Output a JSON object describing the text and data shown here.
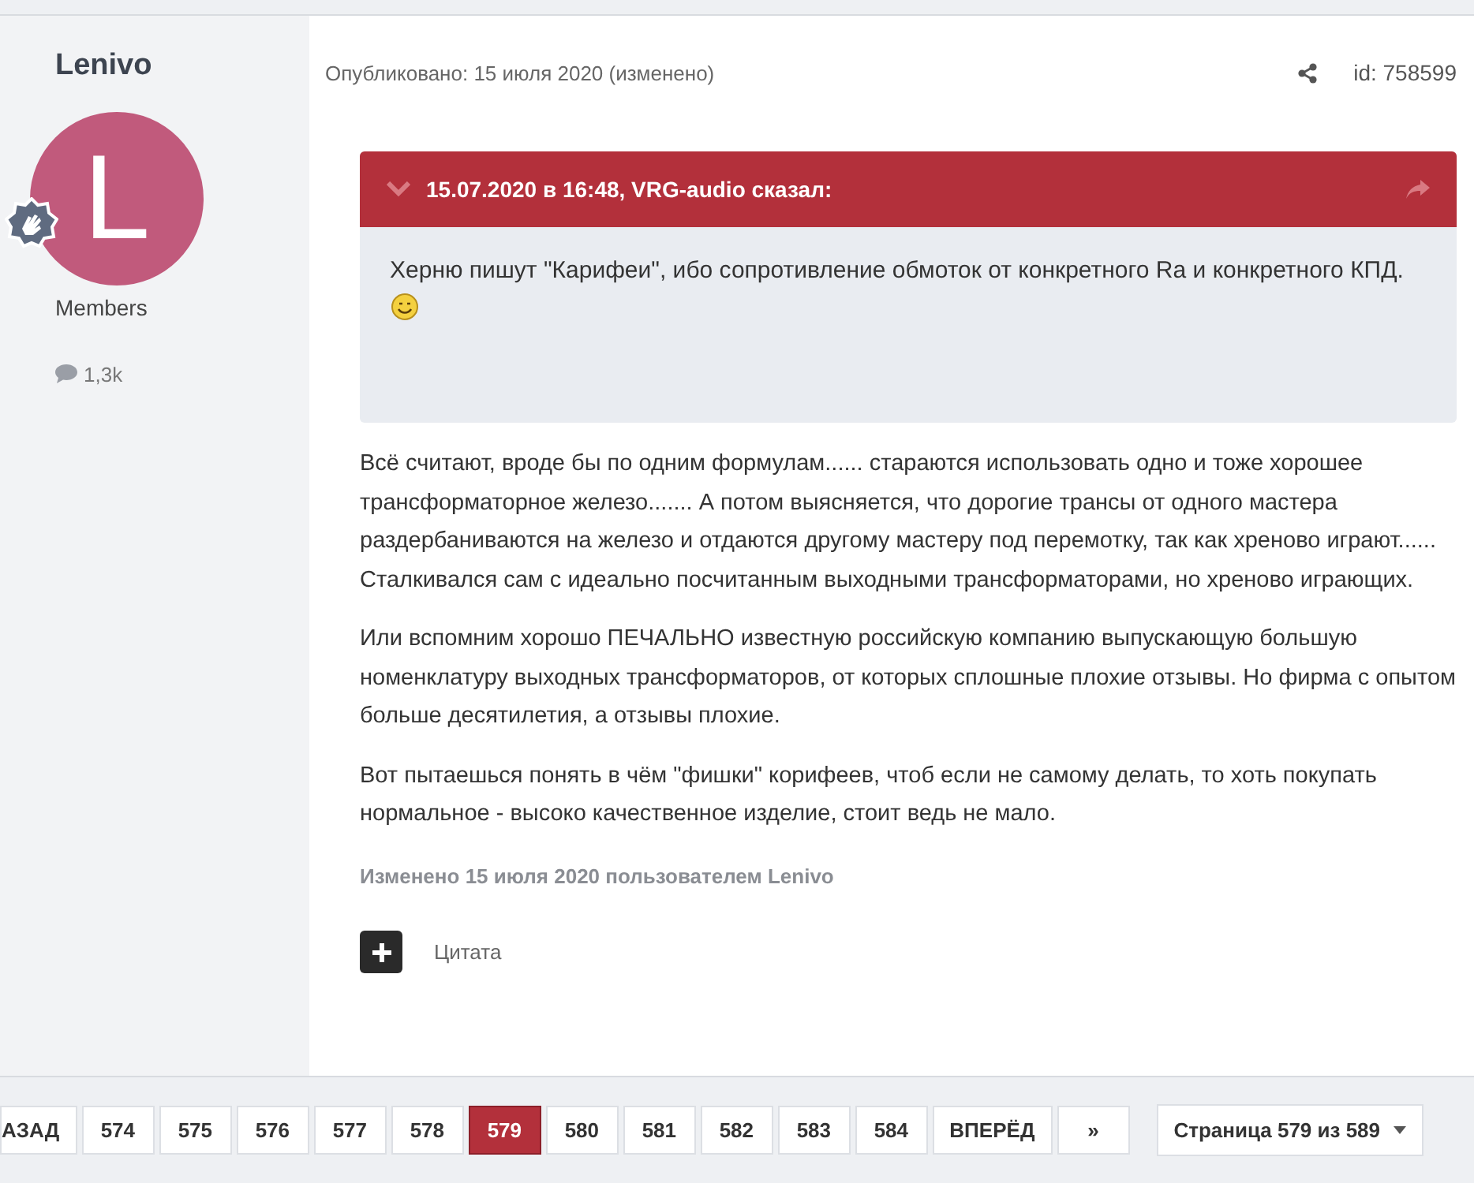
{
  "author": {
    "name": "Lenivo",
    "avatar_letter": "L",
    "group": "Members",
    "posts": "1,3k"
  },
  "post": {
    "published": "Опубликовано: 15 июля 2020 (изменено)",
    "id": "id: 758599",
    "quote": {
      "header": "15.07.2020 в 16:48, VRG-audio сказал:",
      "text": "Херню пишут \"Карифеи\", ибо сопротивление обмоток от конкретного Ra и конкретного КПД."
    },
    "paragraphs": [
      "Всё считают, вроде бы по одним формулам...... стараются использовать одно и тоже хорошее трансформаторное железо....... А потом выясняется, что дорогие трансы от одного мастера раздербаниваются на железо и отдаются другому мастеру под перемотку, так как хреново играют...... Сталкивался сам с идеально посчитанным выходными трансформаторами, но хреново играющих.",
      "Или вспомним хорошо ПЕЧАЛЬНО известную российскую компанию выпускающую большую номенклатуру выходных трансформаторов, от которых сплошные плохие отзывы. Но фирма с опытом больше десятилетия, а отзывы плохие.",
      "Вот пытаешься понять в чём \"фишки\" корифеев, чтоб если не самому делать, то хоть покупать нормальное - высоко качественное изделие, стоит ведь не мало."
    ],
    "edited": "Изменено 15 июля 2020 пользователем Lenivo",
    "quote_button": "Цитата"
  },
  "pagination": {
    "pages": [
      {
        "label": "АЗАД",
        "selected": false
      },
      {
        "label": "574",
        "selected": false
      },
      {
        "label": "575",
        "selected": false
      },
      {
        "label": "576",
        "selected": false
      },
      {
        "label": "577",
        "selected": false
      },
      {
        "label": "578",
        "selected": false
      },
      {
        "label": "579",
        "selected": true
      },
      {
        "label": "580",
        "selected": false
      },
      {
        "label": "581",
        "selected": false
      },
      {
        "label": "582",
        "selected": false
      },
      {
        "label": "583",
        "selected": false
      },
      {
        "label": "584",
        "selected": false
      },
      {
        "label": "ВПЕРЁД",
        "selected": false
      },
      {
        "label": "»",
        "selected": false
      }
    ],
    "page_select": "Страница 579 из 589"
  }
}
